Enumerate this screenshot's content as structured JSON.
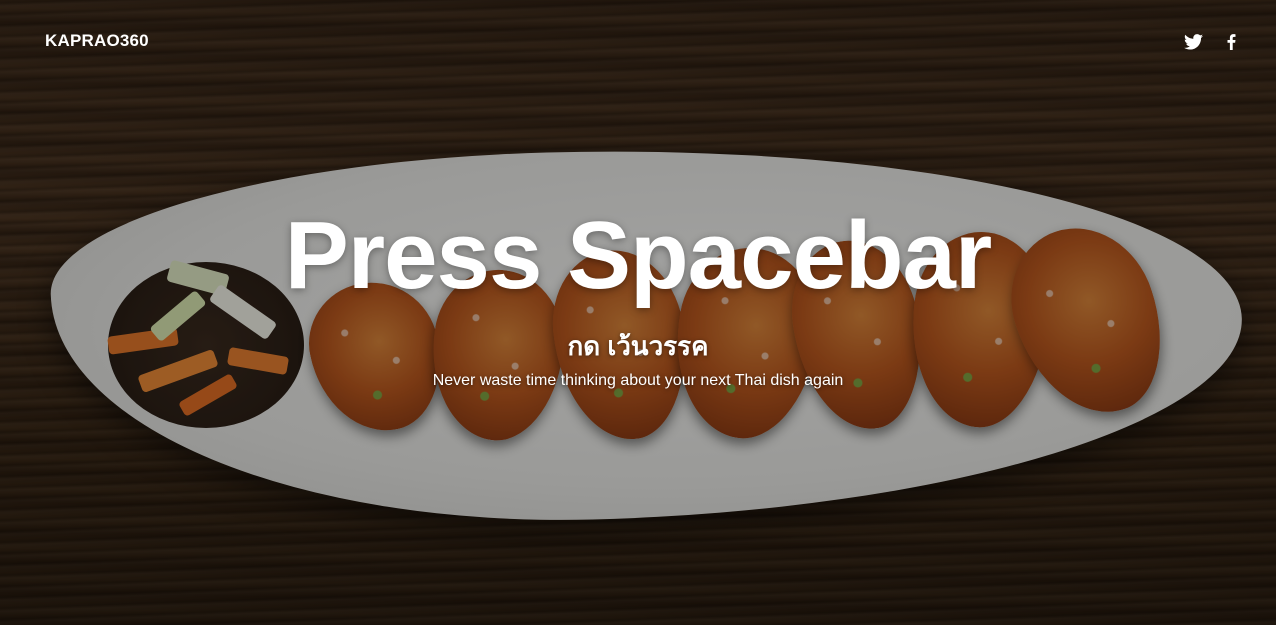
{
  "header": {
    "brand": "KAPRAO360",
    "social": [
      {
        "icon": "twitter-icon"
      },
      {
        "icon": "facebook-icon"
      }
    ]
  },
  "hero": {
    "title": "Press Spacebar",
    "subtitle_thai": "กด เว้นวรรค",
    "tagline": "Never waste time thinking about your next Thai dish again"
  },
  "colors": {
    "text": "#ffffff",
    "wood": "#3e2b1a",
    "plate": "#e6e6e3",
    "sauce": "#b8571e"
  }
}
